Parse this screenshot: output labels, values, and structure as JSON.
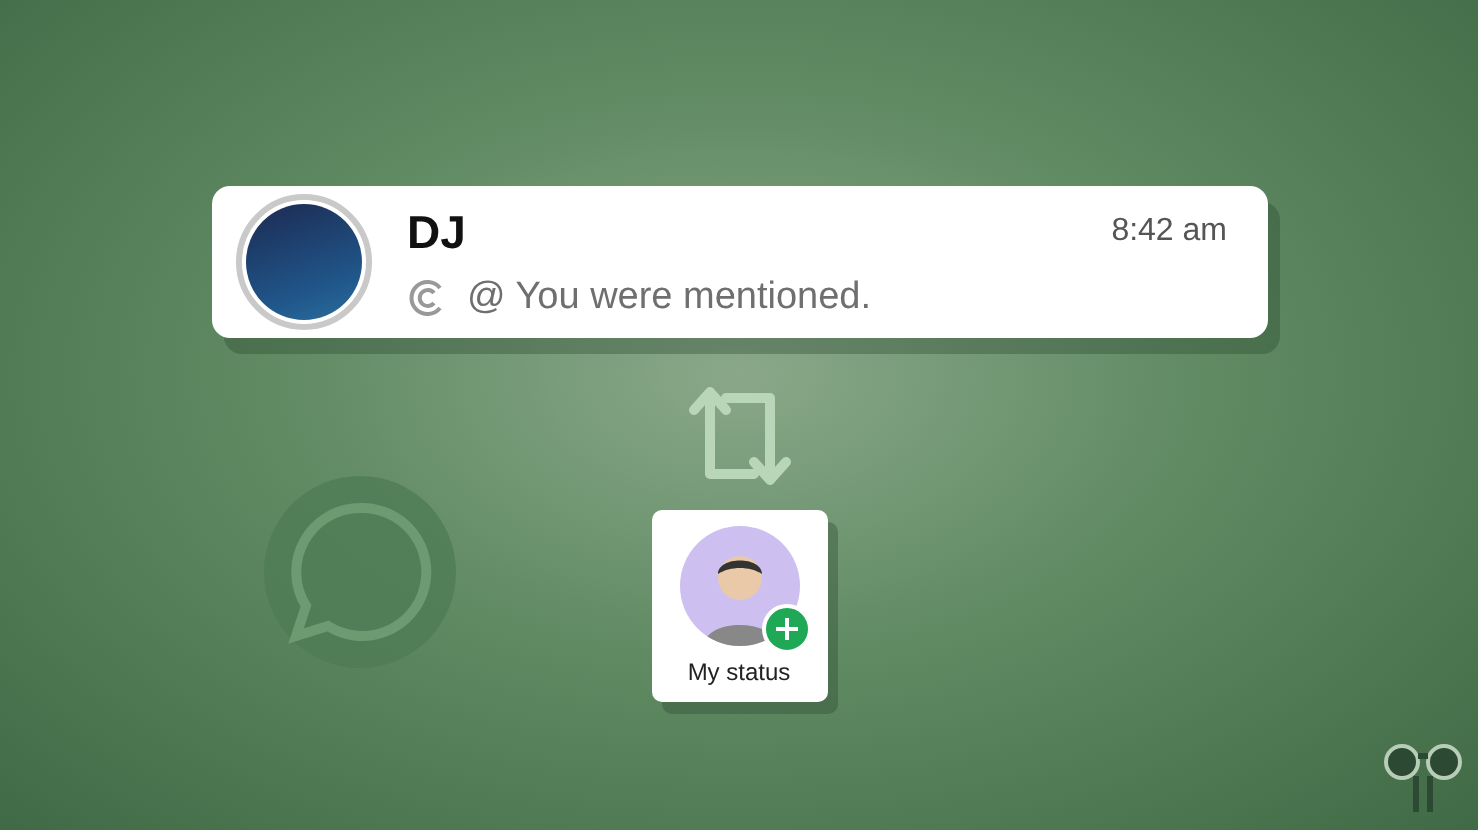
{
  "notification": {
    "sender": "DJ",
    "time": "8:42 am",
    "message": "@ You were mentioned."
  },
  "status": {
    "label": "My status"
  }
}
